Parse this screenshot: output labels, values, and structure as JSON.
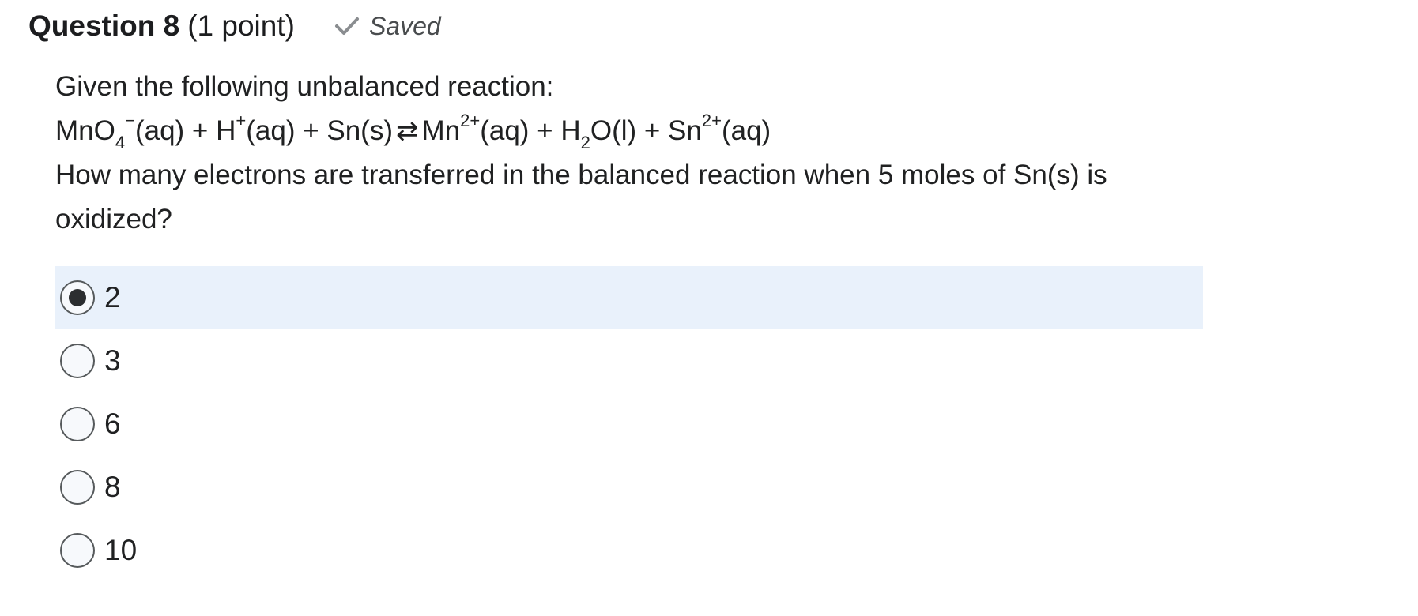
{
  "question": {
    "title": "Question 8",
    "points": "(1 point)",
    "status": {
      "icon": "checkmark-icon",
      "label": "Saved"
    }
  },
  "prompt": {
    "intro": "Given the following unbalanced reaction:",
    "equation": {
      "mno4": "MnO",
      "mno4_sub": "4",
      "mno4_sup": "−",
      "aq1": "(aq) + H",
      "h_sup": "+",
      "aq2": "(aq) + Sn(s)",
      "arrow": "⇄",
      "mn": "Mn",
      "mn_sup": "2+",
      "aq3": "(aq) + H",
      "h2_sub": "2",
      "water": "O(l) + Sn",
      "sn_sup": "2+",
      "aq4": "(aq)"
    },
    "question_text": "How many electrons are transferred in the balanced reaction when 5 moles of Sn(s) is oxidized?"
  },
  "options": [
    {
      "label": "2",
      "selected": true
    },
    {
      "label": "3",
      "selected": false
    },
    {
      "label": "6",
      "selected": false
    },
    {
      "label": "8",
      "selected": false
    },
    {
      "label": "10",
      "selected": false
    }
  ],
  "colors": {
    "selected_background": "#e9f1fb",
    "text": "#202122",
    "check": "#8a8d90"
  }
}
